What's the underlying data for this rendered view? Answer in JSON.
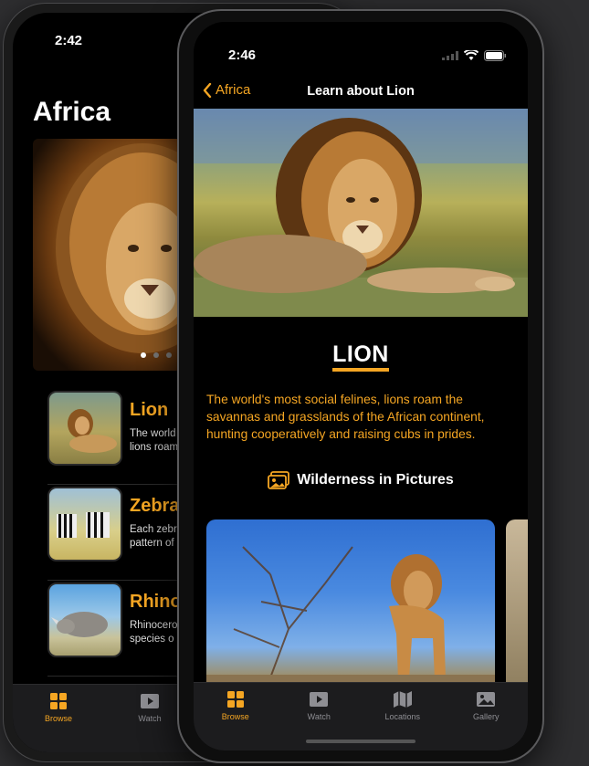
{
  "back_phone": {
    "status_time": "2:42",
    "title": "Africa",
    "carousel_dots": 3,
    "animals": [
      {
        "name": "Lion",
        "desc_line1": "The world",
        "desc_line2": "lions roam"
      },
      {
        "name": "Zebra",
        "desc_line1": "Each zebr",
        "desc_line2": "pattern of"
      },
      {
        "name": "Rhino",
        "desc_line1": "Rhinocero",
        "desc_line2": "species o"
      }
    ],
    "tabs": [
      {
        "label": "Browse",
        "icon": "grid-icon",
        "active": true
      },
      {
        "label": "Watch",
        "icon": "play-icon",
        "active": false
      }
    ]
  },
  "front_phone": {
    "status_time": "2:46",
    "nav": {
      "back_label": "Africa",
      "title": "Learn about Lion"
    },
    "animal_title": "LION",
    "description": "The world's most social felines, lions roam the savannas and grasslands of the African continent, hunting cooperatively and raising cubs in prides.",
    "section_title": "Wilderness in Pictures",
    "tabs": [
      {
        "label": "Browse",
        "icon": "grid-icon",
        "active": true
      },
      {
        "label": "Watch",
        "icon": "play-icon",
        "active": false
      },
      {
        "label": "Locations",
        "icon": "map-icon",
        "active": false
      },
      {
        "label": "Gallery",
        "icon": "photo-icon",
        "active": false
      }
    ]
  },
  "colors": {
    "accent": "#f5a623",
    "background": "#000000",
    "tabbar": "#1c1c1e"
  }
}
